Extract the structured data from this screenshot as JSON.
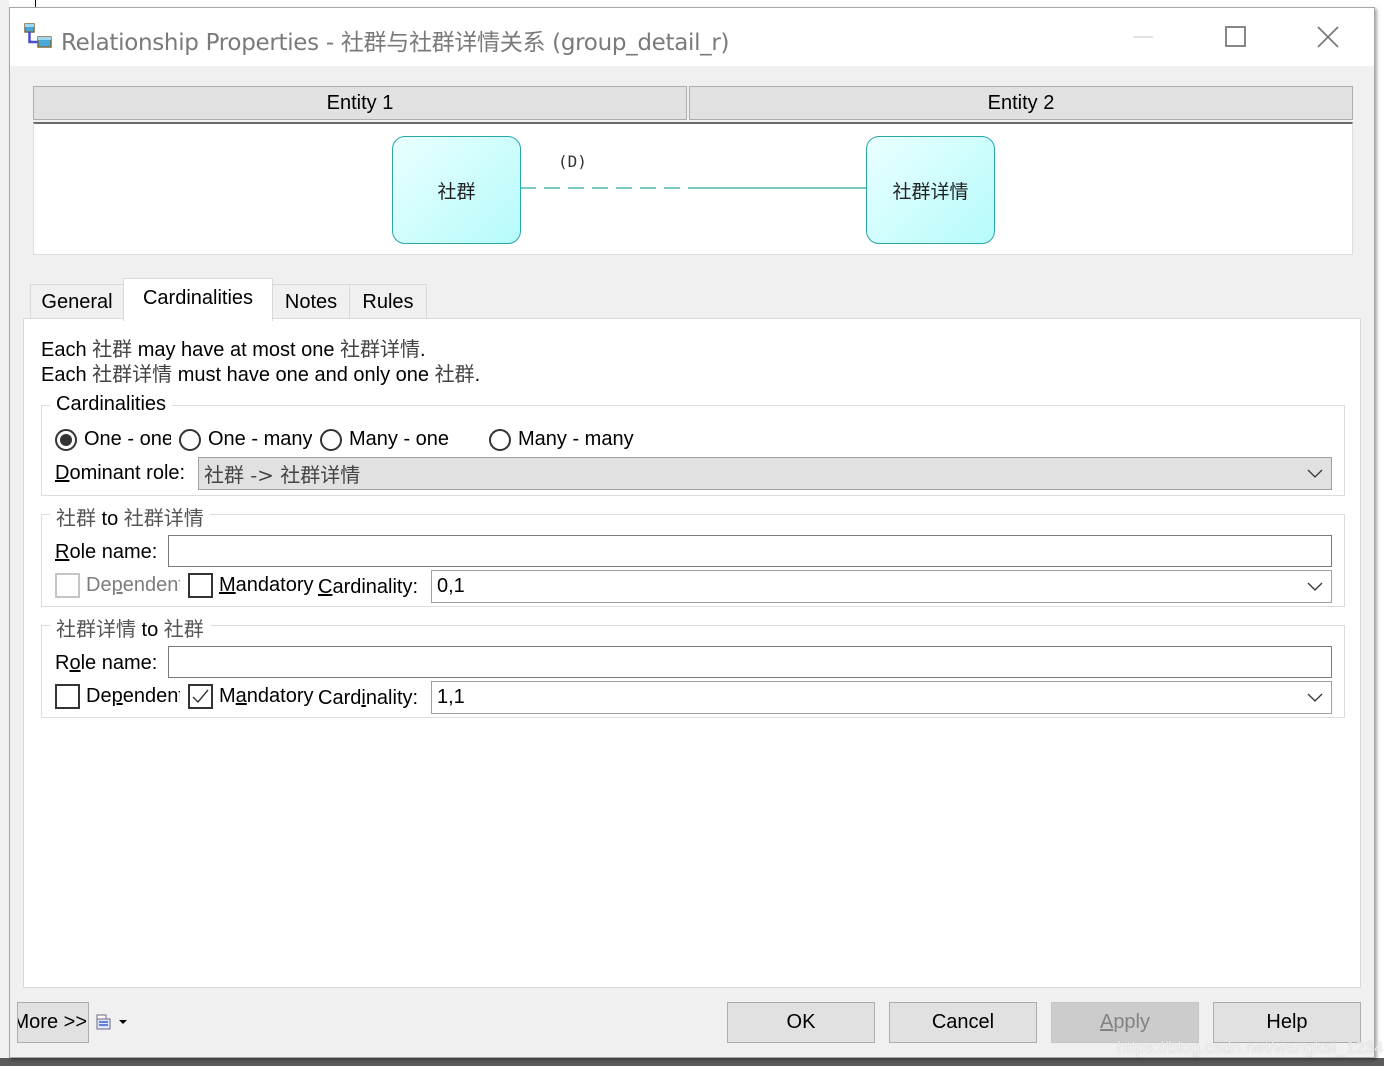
{
  "window": {
    "title": "Relationship Properties - 社群与社群详情关系 (group_detail_r)",
    "icon": "relationship-icon",
    "controls": {
      "minimize": "minimize-icon",
      "maximize": "maximize-icon",
      "close": "close-icon"
    }
  },
  "diagram": {
    "entity1_header": "Entity 1",
    "entity2_header": "Entity 2",
    "entity1_name": "社群",
    "entity2_name": "社群详情",
    "relationship_label": "(D)",
    "colors": {
      "entity_border": "#2aa7a7",
      "entity_fill": "#b6fbfb",
      "line": "#2aa7a7"
    }
  },
  "tabs": [
    {
      "label": "General",
      "active": false
    },
    {
      "label": "Cardinalities",
      "active": true
    },
    {
      "label": "Notes",
      "active": false
    },
    {
      "label": "Rules",
      "active": false
    }
  ],
  "description": {
    "line1": {
      "pre": "Each ",
      "e1": "社群",
      "mid": " may have at most one ",
      "e2": "社群详情",
      "post": "."
    },
    "line2": {
      "pre": "Each ",
      "e1": "社群详情",
      "mid": " must have one and only one ",
      "e2": "社群",
      "post": "."
    }
  },
  "cardinalities": {
    "legend": "Cardinalities",
    "options": [
      {
        "label": "One - one",
        "selected": true
      },
      {
        "label": "One - many",
        "selected": false
      },
      {
        "label": "Many - one",
        "selected": false
      },
      {
        "label": "Many - many",
        "selected": false
      }
    ],
    "dominant_role_label": {
      "accel": "D",
      "rest": "ominant role:"
    },
    "dominant_role_value": "社群 -> 社群详情"
  },
  "role1": {
    "legend": {
      "e1": "社群",
      "mid": " to ",
      "e2": "社群详情"
    },
    "role_name_label": {
      "accel": "R",
      "rest": "ole name:"
    },
    "role_name_value": "",
    "dependent": {
      "label_a": "De",
      "accel": "p",
      "label_b": "endent",
      "checked": false,
      "disabled": true
    },
    "mandatory": {
      "accel": "M",
      "rest": "andatory",
      "checked": false
    },
    "cardinality_label": {
      "accel": "C",
      "rest": "ardinality:"
    },
    "cardinality_value": "0,1"
  },
  "role2": {
    "legend": {
      "e1": "社群详情",
      "mid": " to ",
      "e2": "社群"
    },
    "role_name_label": {
      "a": "R",
      "accel": "o",
      "rest": "le name:"
    },
    "role_name_value": "",
    "dependent": {
      "label_a": "De",
      "accel": "p",
      "label_b": "endent",
      "checked": false,
      "disabled": false
    },
    "mandatory": {
      "a": "M",
      "accel": "a",
      "rest": "ndatory",
      "checked": true
    },
    "cardinality_label": {
      "a": "Card",
      "accel": "i",
      "rest": "nality:"
    },
    "cardinality_value": "1,1"
  },
  "footer": {
    "more_label": "More >>",
    "print_icon": "print-icon",
    "ok_label": "OK",
    "cancel_label": "Cancel",
    "apply_label": {
      "accel": "A",
      "rest": "pply"
    },
    "apply_enabled": false,
    "help_label": "Help"
  },
  "watermark": "https://blog.csdn.net/wangkai_123456"
}
